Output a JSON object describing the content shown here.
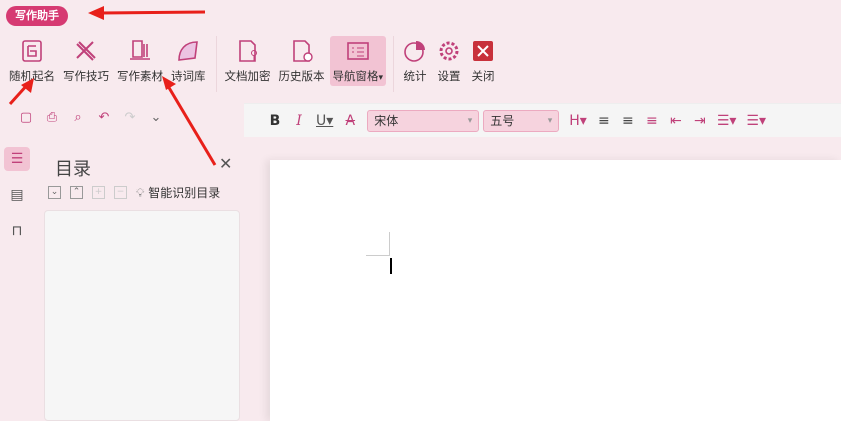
{
  "assistant_badge": "写作助手",
  "ribbon": [
    {
      "label": "随机起名",
      "icon": "name-icon"
    },
    {
      "label": "写作技巧",
      "icon": "pencil-ruler-icon"
    },
    {
      "label": "写作素材",
      "icon": "material-icon"
    },
    {
      "label": "诗词库",
      "icon": "fan-icon"
    },
    {
      "label": "文档加密",
      "icon": "doc-lock-icon"
    },
    {
      "label": "历史版本",
      "icon": "doc-history-icon"
    },
    {
      "label": "导航窗格",
      "icon": "nav-pane-icon"
    },
    {
      "label": "统计",
      "icon": "pie-icon"
    },
    {
      "label": "设置",
      "icon": "gear-icon"
    },
    {
      "label": "关闭",
      "icon": "close-icon"
    }
  ],
  "format": {
    "font": "宋体",
    "size": "五号",
    "dropdown": "▾"
  },
  "toc": {
    "title": "目录",
    "smart": "智能识别目录"
  },
  "colors": {
    "accent": "#d63a72",
    "arrow": "#e8201a"
  }
}
